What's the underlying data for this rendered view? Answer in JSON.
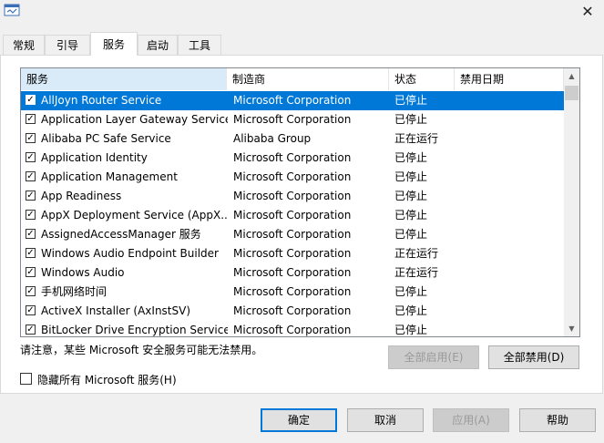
{
  "tabs": [
    {
      "label": "常规",
      "active": false
    },
    {
      "label": "引导",
      "active": false
    },
    {
      "label": "服务",
      "active": true
    },
    {
      "label": "启动",
      "active": false
    },
    {
      "label": "工具",
      "active": false
    }
  ],
  "columns": [
    "服务",
    "制造商",
    "状态",
    "禁用日期"
  ],
  "services": [
    {
      "name": "AllJoyn Router Service",
      "manufacturer": "Microsoft Corporation",
      "status": "已停止",
      "disabled_date": "",
      "checked": true,
      "selected": true
    },
    {
      "name": "Application Layer Gateway Service",
      "manufacturer": "Microsoft Corporation",
      "status": "已停止",
      "disabled_date": "",
      "checked": true
    },
    {
      "name": "Alibaba PC Safe Service",
      "manufacturer": "Alibaba Group",
      "status": "正在运行",
      "disabled_date": "",
      "checked": true
    },
    {
      "name": "Application Identity",
      "manufacturer": "Microsoft Corporation",
      "status": "已停止",
      "disabled_date": "",
      "checked": true
    },
    {
      "name": "Application Management",
      "manufacturer": "Microsoft Corporation",
      "status": "已停止",
      "disabled_date": "",
      "checked": true
    },
    {
      "name": "App Readiness",
      "manufacturer": "Microsoft Corporation",
      "status": "已停止",
      "disabled_date": "",
      "checked": true
    },
    {
      "name": "AppX Deployment Service (AppX...",
      "manufacturer": "Microsoft Corporation",
      "status": "已停止",
      "disabled_date": "",
      "checked": true
    },
    {
      "name": "AssignedAccessManager 服务",
      "manufacturer": "Microsoft Corporation",
      "status": "已停止",
      "disabled_date": "",
      "checked": true
    },
    {
      "name": "Windows Audio Endpoint Builder",
      "manufacturer": "Microsoft Corporation",
      "status": "正在运行",
      "disabled_date": "",
      "checked": true
    },
    {
      "name": "Windows Audio",
      "manufacturer": "Microsoft Corporation",
      "status": "正在运行",
      "disabled_date": "",
      "checked": true
    },
    {
      "name": "手机网络时间",
      "manufacturer": "Microsoft Corporation",
      "status": "已停止",
      "disabled_date": "",
      "checked": true
    },
    {
      "name": "ActiveX Installer (AxInstSV)",
      "manufacturer": "Microsoft Corporation",
      "status": "已停止",
      "disabled_date": "",
      "checked": true
    },
    {
      "name": "BitLocker Drive Encryption Service",
      "manufacturer": "Microsoft Corporation",
      "status": "已停止",
      "disabled_date": "",
      "checked": true
    }
  ],
  "note": "请注意，某些 Microsoft 安全服务可能无法禁用。",
  "enable_all": "全部启用(E)",
  "disable_all": "全部禁用(D)",
  "hide_ms_label": "隐藏所有 Microsoft 服务(H)",
  "hide_ms_checked": false,
  "footer": {
    "ok": "确定",
    "cancel": "取消",
    "apply": "应用(A)",
    "help": "帮助"
  },
  "icons": {
    "app": "msconfig-window-icon",
    "close": "close-icon",
    "check": "✓",
    "close_glyph": "✕",
    "up": "▲",
    "down": "▼"
  },
  "colors": {
    "selection": "#0078d7",
    "header_sorted": "#d9ebf9"
  }
}
